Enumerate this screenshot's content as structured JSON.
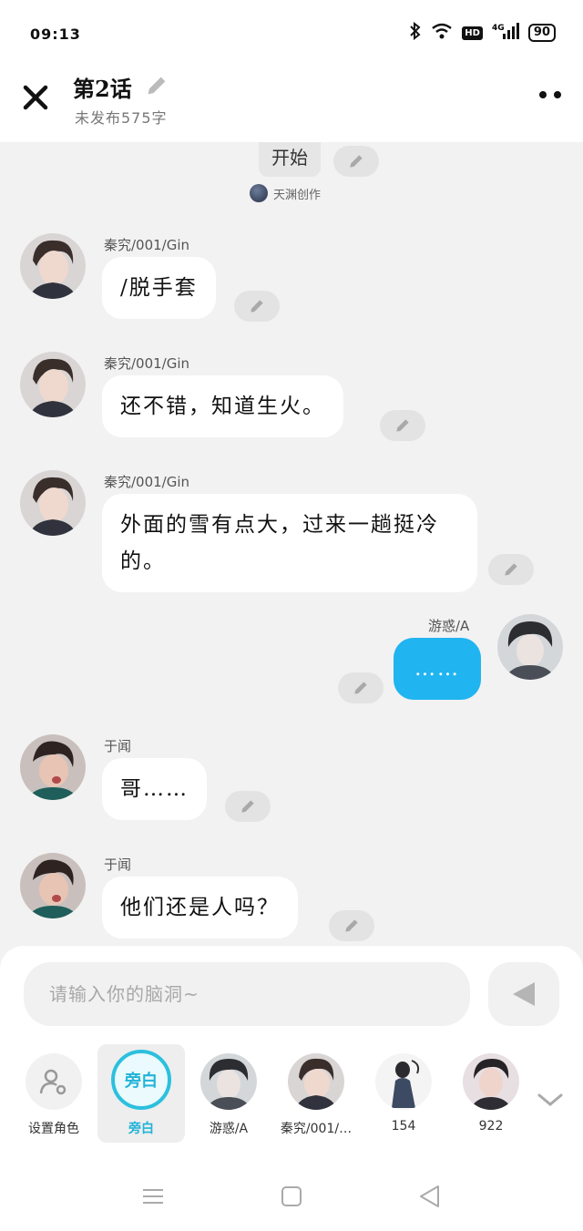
{
  "status_bar": {
    "time": "09:13",
    "network": "4G",
    "hd": "HD",
    "battery": "90"
  },
  "header": {
    "title": "第2话",
    "subtitle": "未发布575字"
  },
  "chat": {
    "start_label": "开始",
    "creator": "天渊创作",
    "messages": [
      {
        "speaker": "秦究/001/Gin",
        "text": "/脱手套",
        "side": "left"
      },
      {
        "speaker": "秦究/001/Gin",
        "text": "还不错，知道生火。",
        "side": "left"
      },
      {
        "speaker": "秦究/001/Gin",
        "text": "外面的雪有点大，过来一趟挺冷的。",
        "side": "left"
      },
      {
        "speaker": "游惑/A",
        "text": "……",
        "side": "right"
      },
      {
        "speaker": "于闻",
        "text": "哥……",
        "side": "left"
      },
      {
        "speaker": "于闻",
        "text": "他们还是人吗？",
        "side": "left"
      }
    ]
  },
  "composer": {
    "placeholder": "请输入你的脑洞~"
  },
  "roles": [
    {
      "label": "设置角色",
      "icon": "person-settings-icon"
    },
    {
      "label": "旁白",
      "badge": "旁白",
      "selected": true
    },
    {
      "label": "游惑/A"
    },
    {
      "label": "秦究/001/…"
    },
    {
      "label": "154"
    },
    {
      "label": "922"
    }
  ],
  "colors": {
    "accent_blue": "#20b4f0",
    "narrator_cyan": "#2bc0de",
    "background": "#f2f2f2"
  }
}
